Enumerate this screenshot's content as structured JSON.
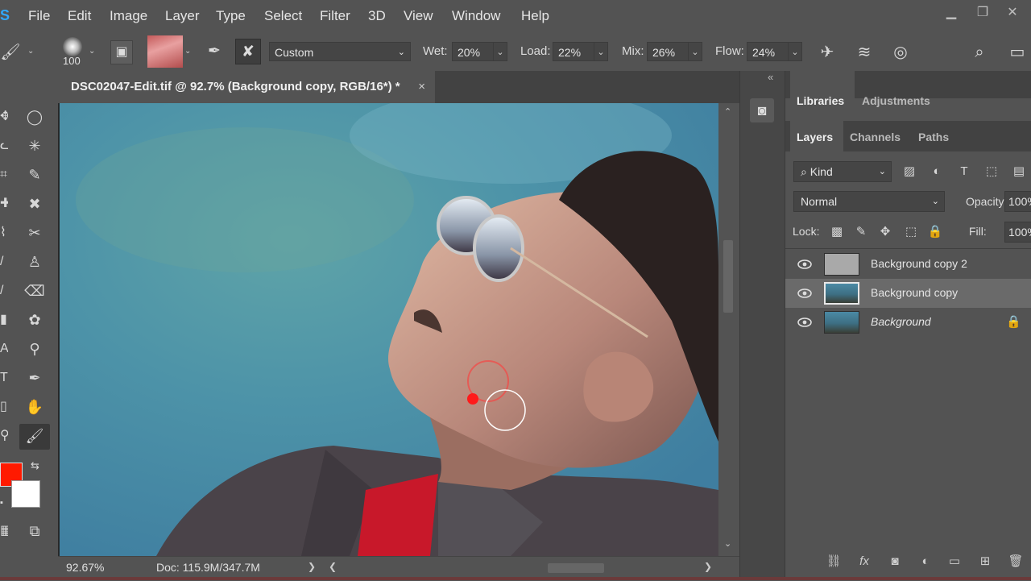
{
  "menubar": {
    "logo": "S",
    "items": [
      "File",
      "Edit",
      "Image",
      "Layer",
      "Type",
      "Select",
      "Filter",
      "3D",
      "View",
      "Window",
      "Help"
    ]
  },
  "options": {
    "brush_size": "100",
    "preset": "Custom",
    "wet_label": "Wet:",
    "wet_value": "20%",
    "load_label": "Load:",
    "load_value": "22%",
    "mix_label": "Mix:",
    "mix_value": "26%",
    "flow_label": "Flow:",
    "flow_value": "24%"
  },
  "document": {
    "tab_title": "DSC02047-Edit.tif @ 92.7% (Background copy, RGB/16*) *",
    "close": "×",
    "zoom": "92.67%",
    "doc_info": "Doc: 115.9M/347.7M",
    "status_arrow": "❯"
  },
  "panels": {
    "top_tabs": [
      "Libraries",
      "Adjustments"
    ],
    "layer_tabs": [
      "Layers",
      "Channels",
      "Paths"
    ],
    "filter_kind": "Kind",
    "blend_mode": "Normal",
    "opacity_label": "Opacity:",
    "opacity_value": "100%",
    "lock_label": "Lock:",
    "fill_label": "Fill:",
    "fill_value": "100%",
    "collapse": "«",
    "layers": [
      {
        "name": "Background copy 2",
        "visible": true,
        "selected": false,
        "locked": false
      },
      {
        "name": "Background copy",
        "visible": true,
        "selected": true,
        "locked": false
      },
      {
        "name": "Background",
        "visible": true,
        "selected": false,
        "locked": true
      }
    ]
  },
  "colors": {
    "foreground": "#ff1a00",
    "background": "#ffffff",
    "ui_bg": "#535353",
    "accent": "#31a8ff"
  }
}
